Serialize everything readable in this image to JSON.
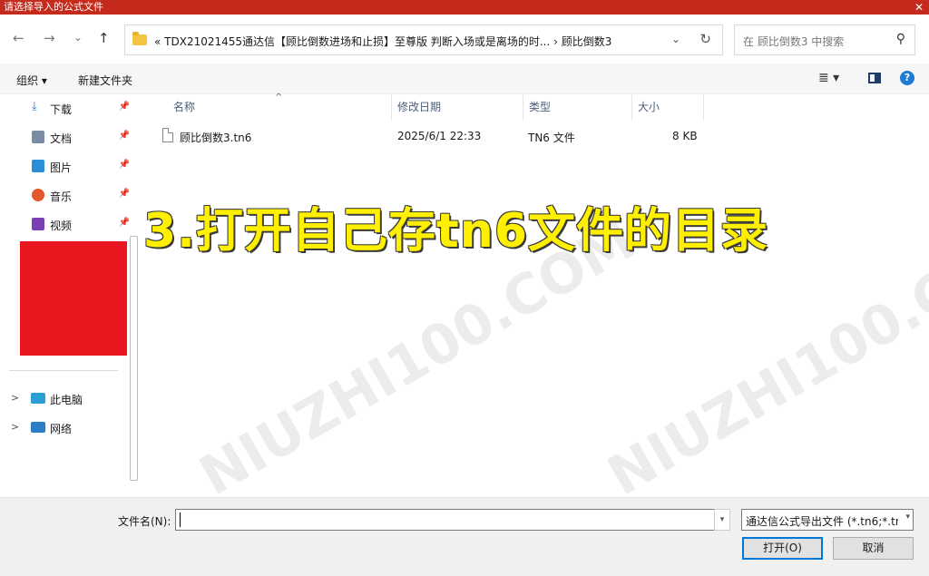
{
  "window": {
    "title": "请选择导入的公式文件",
    "close_glyph": "✕"
  },
  "nav": {
    "back_glyph": "←",
    "forward_glyph": "→",
    "recent_glyph": "⌄",
    "up_glyph": "↑",
    "breadcrumb": "«  TDX21021455通达信【顾比倒数进场和止损】至尊版 判断入场或是离场的时...  ›  顾比倒数3",
    "dropdown_glyph": "⌄",
    "refresh_glyph": "↻",
    "search_placeholder": "在 顾比倒数3 中搜索",
    "search_glyph": "⚲"
  },
  "toolbar": {
    "organize_label": "组织 ▾",
    "new_folder_label": "新建文件夹",
    "view_glyph": "≣ ▾",
    "help_glyph": "?"
  },
  "sidebar": {
    "quick_access": [
      {
        "label": "下载",
        "icon": "download-icon",
        "color": "#1e7bd1",
        "pin": "📌"
      },
      {
        "label": "文档",
        "icon": "document-icon",
        "color": "#7a8ba3",
        "pin": "📌"
      },
      {
        "label": "图片",
        "icon": "pictures-icon",
        "color": "#2b8fd8",
        "pin": "📌"
      },
      {
        "label": "音乐",
        "icon": "music-icon",
        "color": "#e3572b",
        "pin": "📌"
      },
      {
        "label": "视频",
        "icon": "videos-icon",
        "color": "#7a3fb5",
        "pin": "📌"
      }
    ],
    "tree": [
      {
        "chevron": ">",
        "label": "此电脑",
        "icon": "computer-icon",
        "color": "#2b9ed6"
      },
      {
        "chevron": ">",
        "label": "网络",
        "icon": "network-icon",
        "color": "#2b7fc6"
      }
    ]
  },
  "files": {
    "columns": [
      "名称",
      "修改日期",
      "类型",
      "大小"
    ],
    "sort_glyph": "^",
    "rows": [
      {
        "name": "顾比倒数3.tn6",
        "modified": "2025/6/1 22:33",
        "type": "TN6 文件",
        "size": "8 KB"
      }
    ]
  },
  "overlay": {
    "caption": "3.打开自己存tn6文件的目录"
  },
  "watermark": {
    "text": "NIUZHI100.COM"
  },
  "footer": {
    "filename_label": "文件名(N):",
    "filename_value": "",
    "filename_dd_glyph": "▾",
    "filetype_value": "通达信公式导出文件 (*.tn6;*.tn",
    "filetype_dd_glyph": "▾",
    "open_label": "打开(O)",
    "cancel_label": "取消"
  }
}
